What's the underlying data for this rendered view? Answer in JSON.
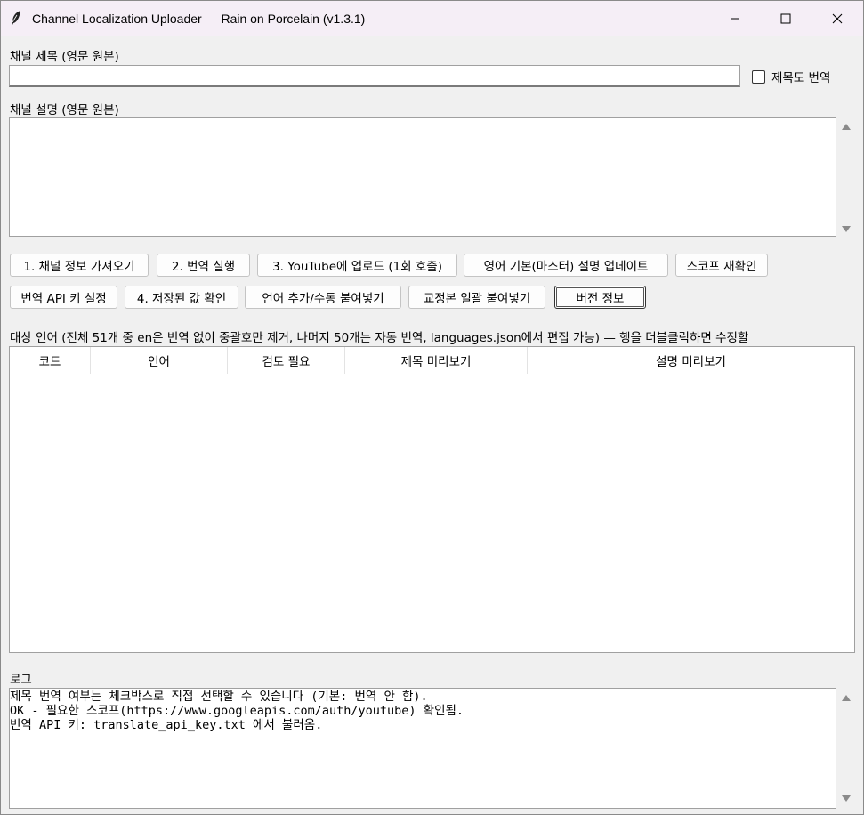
{
  "window": {
    "title": "Channel Localization Uploader — Rain on Porcelain (v1.3.1)"
  },
  "form": {
    "title_label": "채널 제목 (영문 원본)",
    "title_value": "",
    "translate_title_label": "제목도 번역",
    "description_label": "채널 설명 (영문 원본)",
    "description_value": ""
  },
  "buttons": {
    "row1": [
      "1. 채널 정보 가져오기",
      "2. 번역 실행",
      "3. YouTube에 업로드 (1회 호출)",
      "영어 기본(마스터) 설명 업데이트",
      "스코프 재확인"
    ],
    "row2": [
      "번역 API 키 설정",
      "4. 저장된 값 확인",
      "언어 추가/수동 붙여넣기",
      "교정본 일괄 붙여넣기",
      "버전 정보"
    ]
  },
  "languages": {
    "caption": "대상 언어 (전체 51개 중 en은 번역 없이 중괄호만 제거, 나머지 50개는 자동 번역, languages.json에서 편집 가능) — 행을 더블클릭하면 수정할",
    "columns": [
      "코드",
      "언어",
      "검토 필요",
      "제목 미리보기",
      "설명 미리보기"
    ],
    "rows": []
  },
  "log": {
    "label": "로그",
    "lines": [
      "제목 번역 여부는 체크박스로 직접 선택할 수 있습니다 (기본: 번역 안 함).",
      "OK - 필요한 스코프(https://www.googleapis.com/auth/youtube) 확인됨.",
      "번역 API 키: translate_api_key.txt 에서 불러옴."
    ]
  },
  "icons": {
    "app": "feather-icon",
    "minimize": "minimize-icon",
    "maximize": "maximize-icon",
    "close": "close-icon"
  }
}
